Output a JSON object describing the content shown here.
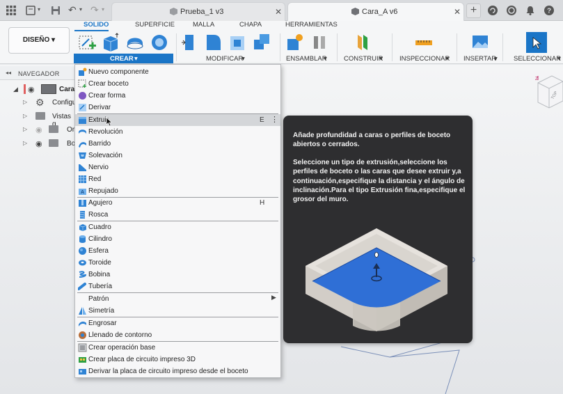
{
  "tabs": [
    {
      "label": "Prueba_1 v3",
      "active": false
    },
    {
      "label": "Cara_A v6",
      "active": true
    }
  ],
  "workspace": {
    "design_label": "DISEÑO",
    "tabs": [
      "SOLIDO",
      "SUPERFICIE",
      "MALLA",
      "CHAPA",
      "HERRAMIENTAS"
    ]
  },
  "groups": {
    "crear": "CREAR",
    "modificar": "MODIFICAR",
    "ensamblar": "ENSAMBLAR",
    "construir": "CONSTRUIR",
    "inspeccionar": "INSPECCIONAR",
    "insertar": "INSERTAR",
    "seleccionar": "SELECCIONAR"
  },
  "navigator": {
    "title": "NAVEGADOR",
    "rows": [
      "Cara",
      "Configu",
      "Vistas g",
      "Or",
      "Bo"
    ]
  },
  "menu": {
    "items": [
      {
        "label": "Nuevo componente"
      },
      {
        "label": "Crear boceto"
      },
      {
        "label": "Crear forma"
      },
      {
        "label": "Derivar"
      },
      {
        "label": "Extruir",
        "shortcut": "E"
      },
      {
        "label": "Revolución"
      },
      {
        "label": "Barrido"
      },
      {
        "label": "Solevación"
      },
      {
        "label": "Nervio"
      },
      {
        "label": "Red"
      },
      {
        "label": "Repujado"
      },
      {
        "label": "Agujero",
        "shortcut": "H"
      },
      {
        "label": "Rosca"
      },
      {
        "label": "Cuadro"
      },
      {
        "label": "Cilindro"
      },
      {
        "label": "Esfera"
      },
      {
        "label": "Toroide"
      },
      {
        "label": "Bobina"
      },
      {
        "label": "Tubería"
      },
      {
        "label": "Patrón"
      },
      {
        "label": "Simetría"
      },
      {
        "label": "Engrosar"
      },
      {
        "label": "Llenado de contorno"
      },
      {
        "label": "Crear operación base"
      },
      {
        "label": "Crear placa de circuito impreso 3D"
      },
      {
        "label": "Derivar la placa de circuito impreso desde el boceto"
      }
    ]
  },
  "tooltip": {
    "para1": "Añade profundidad a caras o perfiles de boceto abiertos o cerrados.",
    "para2": "Seleccione un tipo de extrusión,seleccione los perfiles de boceto o las caras que desee extruir y,a continuación,especifique la distancia y el ángulo de inclinación.Para el tipo Extrusión fina,especifique el grosor del muro."
  },
  "colors": {
    "accent": "#1a75c7",
    "tooltip_bg": "#2e2e30",
    "menu_highlight": "#d4d6d9"
  }
}
